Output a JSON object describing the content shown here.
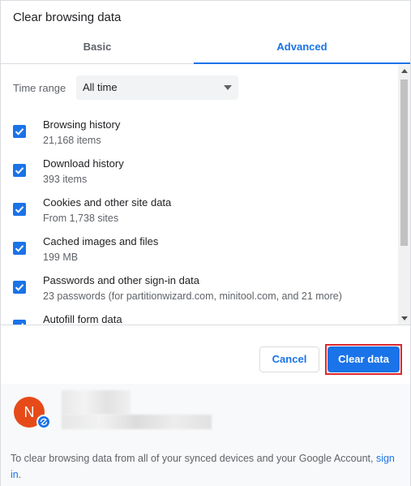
{
  "dialog": {
    "title": "Clear browsing data"
  },
  "tabs": [
    {
      "label": "Basic",
      "selected": false
    },
    {
      "label": "Advanced",
      "selected": true
    }
  ],
  "time_range": {
    "label": "Time range",
    "value": "All time"
  },
  "items": [
    {
      "title": "Browsing history",
      "desc": "21,168 items",
      "checked": true
    },
    {
      "title": "Download history",
      "desc": "393 items",
      "checked": true
    },
    {
      "title": "Cookies and other site data",
      "desc": "From 1,738 sites",
      "checked": true
    },
    {
      "title": "Cached images and files",
      "desc": "199 MB",
      "checked": true
    },
    {
      "title": "Passwords and other sign-in data",
      "desc": "23 passwords (for partitionwizard.com, minitool.com, and 21 more)",
      "checked": true
    },
    {
      "title": "Autofill form data",
      "desc": "",
      "checked": true
    }
  ],
  "buttons": {
    "cancel": "Cancel",
    "clear": "Clear data"
  },
  "account": {
    "avatar_letter": "N"
  },
  "sync_notice": {
    "text": "To clear browsing data from all of your synced devices and your Google Account,",
    "link": "sign in",
    "suffix": "."
  },
  "colors": {
    "accent": "#1a73e8",
    "highlight_outline": "#e0282e",
    "avatar": "#e64a19"
  },
  "icons": {
    "checkbox": "checkmark-icon",
    "dropdown": "chevron-down-icon",
    "sync": "sync-icon"
  }
}
